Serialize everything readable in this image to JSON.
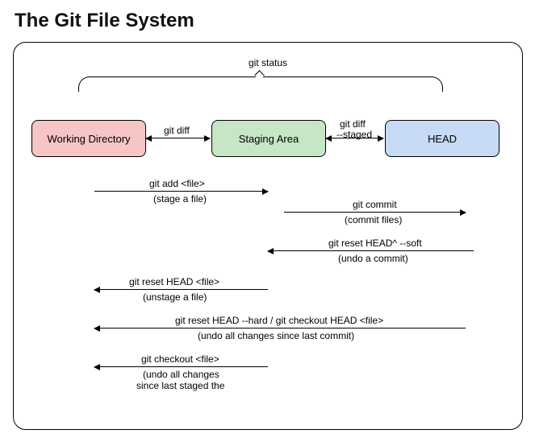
{
  "title": "The Git File System",
  "top_label": "git status",
  "boxes": {
    "working": "Working Directory",
    "staging": "Staging Area",
    "head": "HEAD"
  },
  "between": {
    "ws": "git diff",
    "sh_a": "git diff",
    "sh_b": "--staged"
  },
  "rows": {
    "add": {
      "cmd": "git add <file>",
      "note": "(stage a file)"
    },
    "commit": {
      "cmd": "git commit",
      "note": "(commit files)"
    },
    "softreset": {
      "cmd": "git reset HEAD^ --soft",
      "note": "(undo a commit)"
    },
    "unstage": {
      "cmd": "git reset HEAD <file>",
      "note": "(unstage a file)"
    },
    "hardreset": {
      "cmd": "git reset HEAD --hard / git checkout HEAD <file>",
      "note": "(undo all changes since last commit)"
    },
    "checkout": {
      "cmd": "git checkout <file>",
      "note_a": "(undo all changes",
      "note_b": "since last staged the"
    }
  }
}
